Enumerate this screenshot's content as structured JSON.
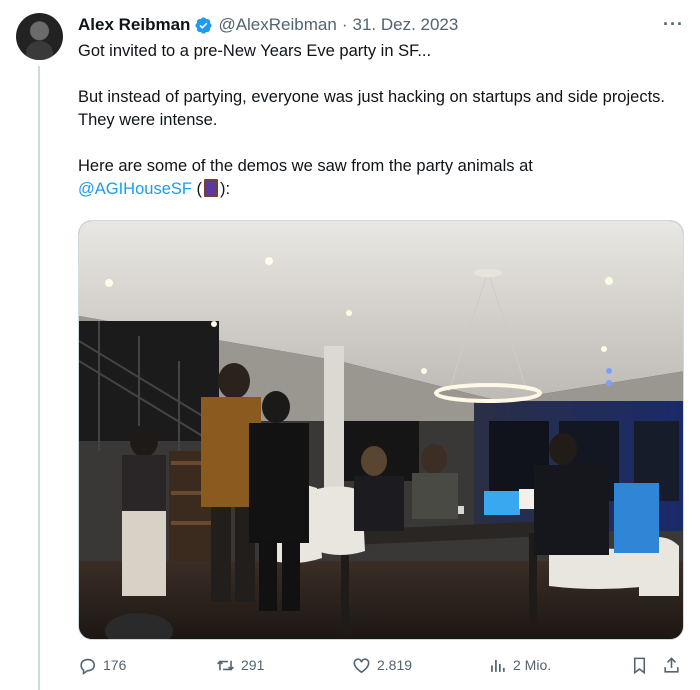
{
  "author": {
    "name": "Alex Reibman",
    "handle": "@AlexReibman",
    "separator": "·",
    "date": "31. Dez. 2023",
    "verified": true
  },
  "tweet": {
    "line1": "Got invited to a pre-New Years Eve party in SF...",
    "line2": "But instead of partying, everyone was just hacking on startups and side projects. They were intense.",
    "line3_prefix": "Here are some of the demos we saw from the party animals at",
    "mention": "@AGIHouseSF",
    "line3_suffix_open": " (",
    "line3_suffix_close": "):"
  },
  "media": {
    "kind": "photo",
    "subject": "people-working-at-a-house-party"
  },
  "actions": {
    "replies": "176",
    "retweets": "291",
    "likes": "2.819",
    "views": "2 Mio."
  },
  "icons": [
    "verified-icon",
    "more-icon",
    "reply-icon",
    "retweet-icon",
    "like-icon",
    "views-icon",
    "bookmark-icon",
    "share-icon"
  ],
  "colors": {
    "accent": "#1d9bf0",
    "secondary_text": "#536471",
    "text": "#0f1419"
  }
}
